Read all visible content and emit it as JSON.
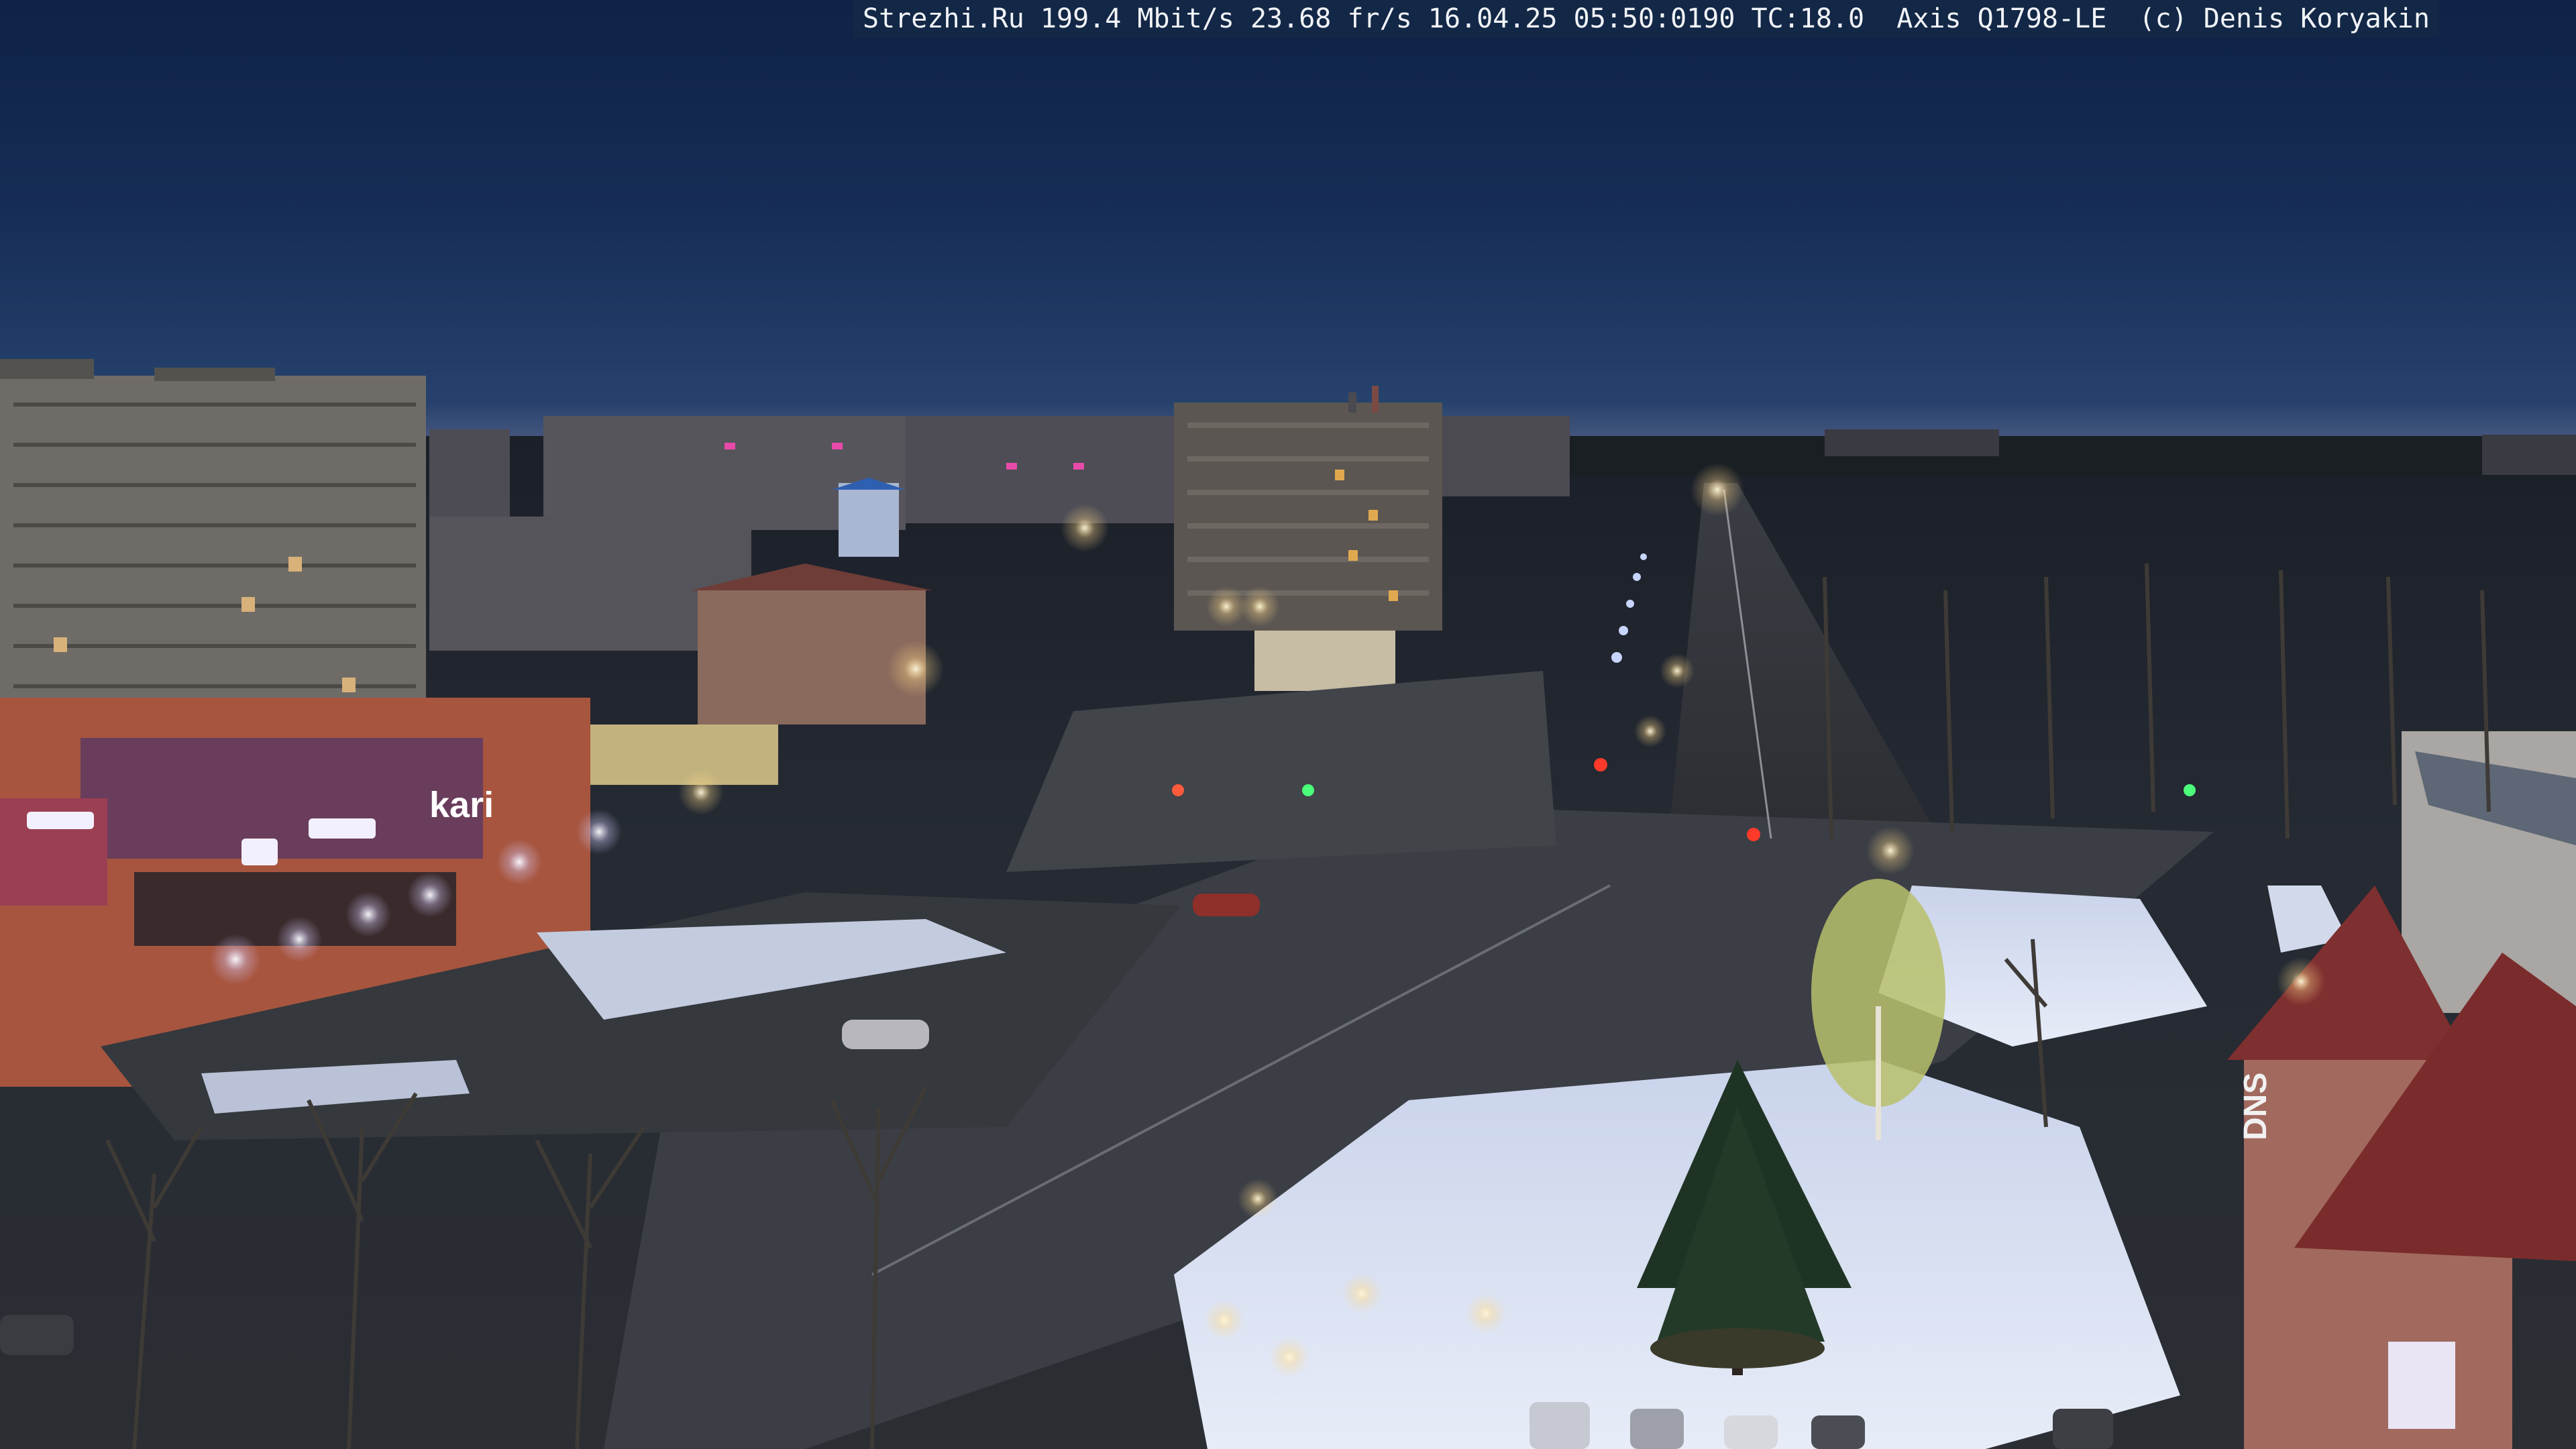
{
  "osd": {
    "text": "Strezhi.Ru 199.4 Mbit/s 23.68 fr/s 16.04.25 05:50:0190 TC:18.0  Axis Q1798-LE  (c) Denis Koryakin"
  },
  "signs": {
    "store_banner": "kari",
    "building_right": "DNS"
  },
  "colors": {
    "sky_top": "#0f2247",
    "sky_horizon": "#2e4a72",
    "snow": "#dfe6f5",
    "street_light": "#fff6d6",
    "led_lamp": "#f4f0ff",
    "facade_red": "#a7553f"
  }
}
